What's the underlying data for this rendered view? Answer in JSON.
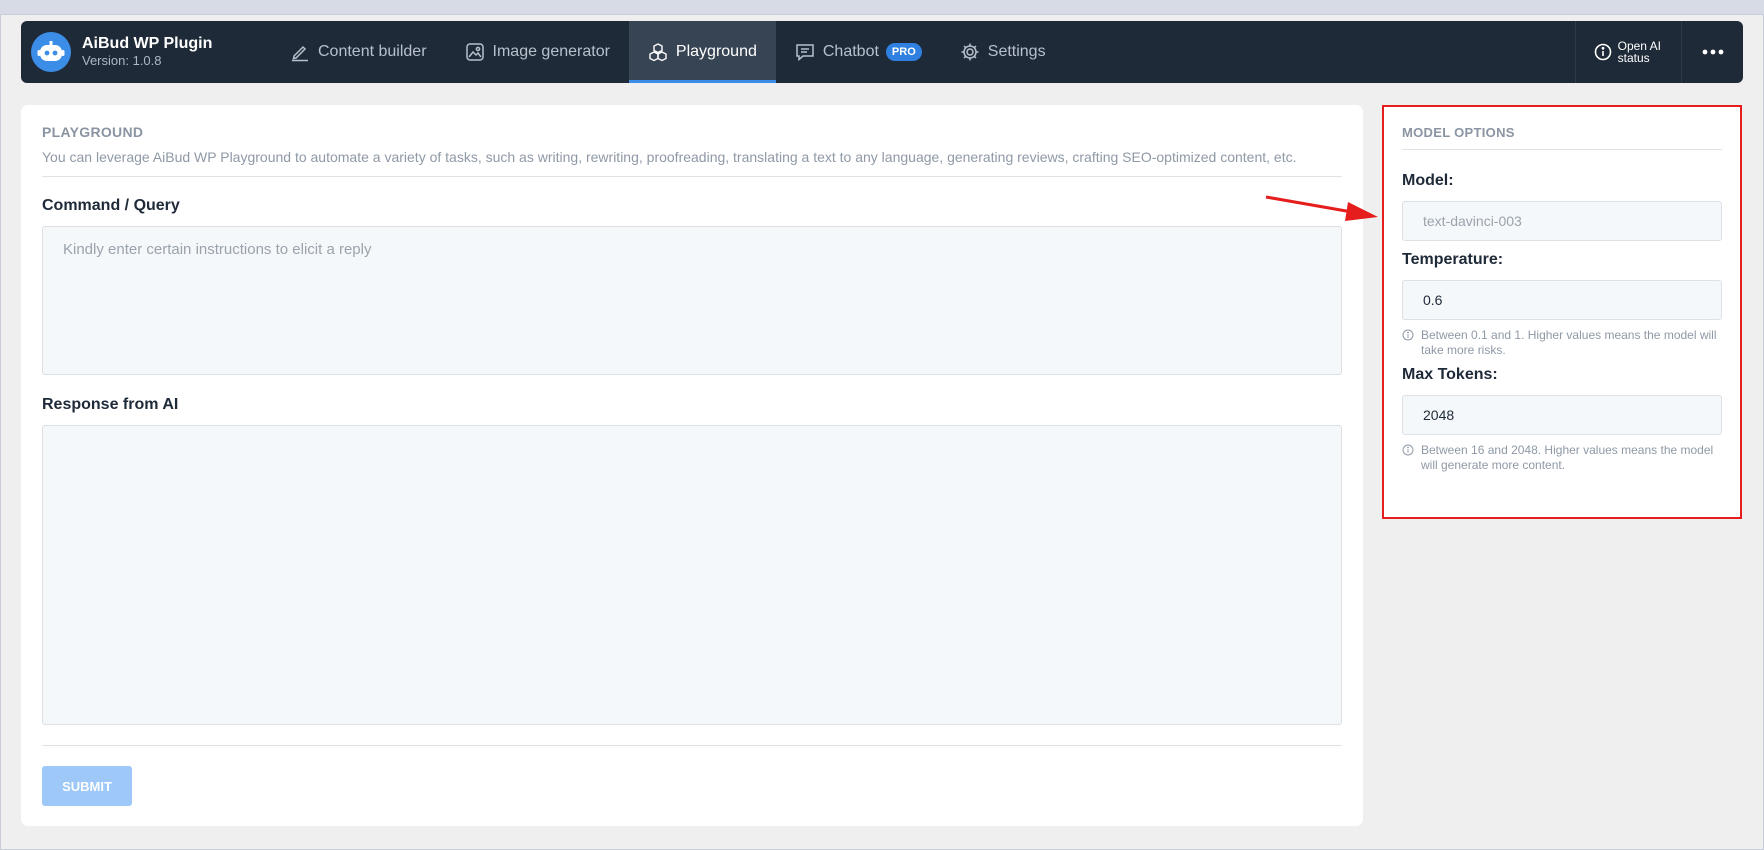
{
  "app": {
    "title": "AiBud WP Plugin",
    "version": "Version: 1.0.8"
  },
  "nav": {
    "content_builder": "Content builder",
    "image_generator": "Image generator",
    "playground": "Playground",
    "chatbot": "Chatbot",
    "chatbot_badge": "PRO",
    "settings": "Settings"
  },
  "topbar": {
    "status_line1": "Open AI",
    "status_line2": "status"
  },
  "playground": {
    "title": "PLAYGROUND",
    "description": "You can leverage AiBud WP Playground to automate a variety of tasks, such as writing, rewriting, proofreading, translating a text to any language, generating reviews, crafting SEO-optimized content, etc.",
    "command_label": "Command / Query",
    "command_placeholder": "Kindly enter certain instructions to elicit a reply",
    "command_value": "",
    "response_label": "Response from AI",
    "response_value": "",
    "submit_label": "SUBMIT"
  },
  "model_options": {
    "title": "MODEL OPTIONS",
    "model_label": "Model:",
    "model_value": "text-davinci-003",
    "temperature_label": "Temperature:",
    "temperature_value": "0.6",
    "temperature_hint": "Between 0.1 and 1. Higher values means the model will take more risks.",
    "max_tokens_label": "Max Tokens:",
    "max_tokens_value": "2048",
    "max_tokens_hint": "Between 16 and 2048. Higher values means the model will generate more content."
  },
  "colors": {
    "topbar_bg": "#1f2a38",
    "accent": "#3b8de8",
    "highlight_border": "#e51d1d",
    "submit_disabled": "#9dc8f7"
  },
  "icons": {
    "logo": "robot-icon",
    "content_builder": "pen-icon",
    "image_generator": "image-icon",
    "playground": "cubes-icon",
    "chatbot": "chat-icon",
    "settings": "gear-icon",
    "status": "info-icon",
    "more": "more-dots-icon"
  }
}
